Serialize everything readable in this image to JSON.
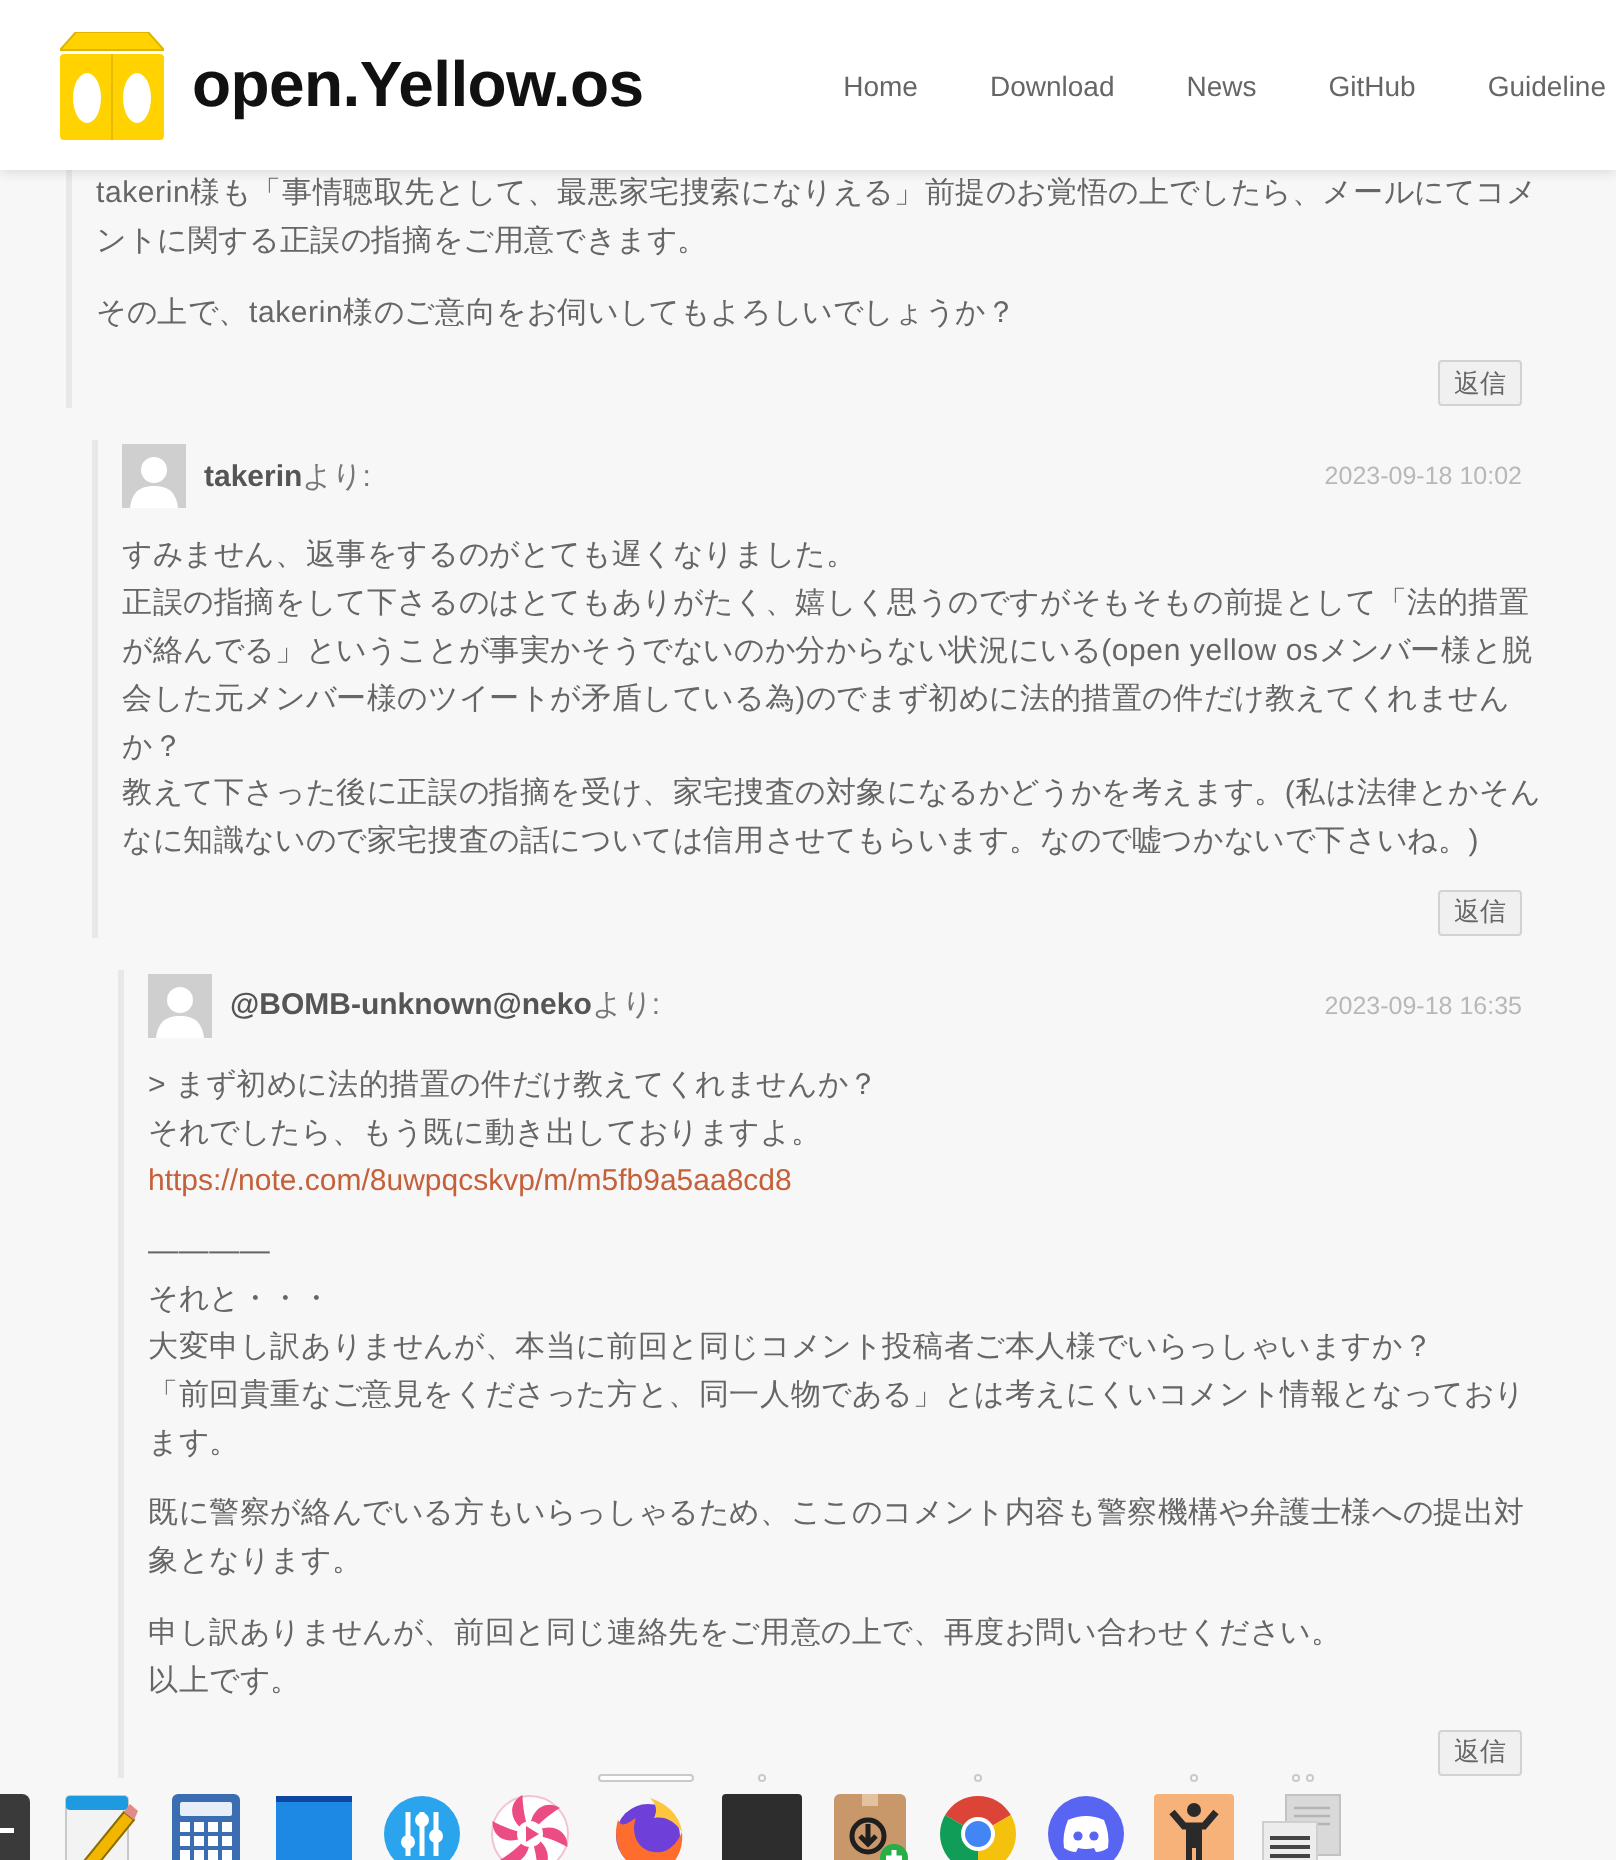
{
  "header": {
    "logo_text": "open.Yellow.os",
    "nav": [
      "Home",
      "Download",
      "News",
      "GitHub",
      "Guideline"
    ]
  },
  "comments": [
    {
      "paragraphs": [
        {
          "lines": [
            {
              "kind": "text",
              "text": "takerin様も「事情聴取先として、最悪家宅捜索になりえる」前提のお覚悟の上でしたら、メールにてコメントに関する正誤の指摘をご用意できます。"
            }
          ]
        },
        {
          "lines": [
            {
              "kind": "text",
              "text": "その上で、takerin様のご意向をお伺いしてもよろしいでしょうか？"
            }
          ]
        }
      ],
      "reply_label": "返信",
      "children": [
        {
          "author": "**takerin**より:",
          "date": "2023-09-18 10:02",
          "paragraphs": [
            {
              "lines": [
                {
                  "kind": "text",
                  "text": "すみません、返事をするのがとても遅くなりました。"
                },
                {
                  "kind": "text",
                  "text": "正誤の指摘をして下さるのはとてもありがたく、嬉しく思うのですがそもそもの前提として「法的措置が絡んでる」ということが事実かそうでないのか分からない状況にいる(open yellow osメンバー様と脱会した元メンバー様のツイートが矛盾している為)のでまず初めに法的措置の件だけ教えてくれませんか？"
                },
                {
                  "kind": "text",
                  "text": "教えて下さった後に正誤の指摘を受け、家宅捜査の対象になるかどうかを考えます。(私は法律とかそんなに知識ないので家宅捜査の話については信用させてもらいます。なので嘘つかないで下さいね。)"
                }
              ]
            }
          ],
          "reply_label": "返信",
          "children": [
            {
              "author": "**@BOMB-unknown@neko**より:",
              "date": "2023-09-18 16:35",
              "paragraphs": [
                {
                  "lines": [
                    {
                      "kind": "text",
                      "text": "> まず初めに法的措置の件だけ教えてくれませんか？"
                    },
                    {
                      "kind": "text",
                      "text": "それでしたら、もう既に動き出しておりますよ。"
                    },
                    {
                      "kind": "link",
                      "text": "https://note.com/8uwpqcskvp/m/m5fb9a5aa8cd8"
                    }
                  ]
                },
                {
                  "lines": [
                    {
                      "kind": "text",
                      "text": "————"
                    },
                    {
                      "kind": "text",
                      "text": "それと・・・"
                    },
                    {
                      "kind": "text",
                      "text": "大変申し訳ありませんが、本当に前回と同じコメント投稿者ご本人様でいらっしゃいますか？"
                    },
                    {
                      "kind": "text",
                      "text": "「前回貴重なご意見をくださった方と、同一人物である」とは考えにくいコメント情報となっております。"
                    }
                  ]
                },
                {
                  "lines": [
                    {
                      "kind": "text",
                      "text": "既に警察が絡んでいる方もいらっしゃるため、ここのコメント内容も警察機構や弁護士様への提出対象となります。"
                    }
                  ]
                },
                {
                  "lines": [
                    {
                      "kind": "text",
                      "text": "申し訳ありませんが、前回と同じ連絡先をご用意の上で、再度お問い合わせください。"
                    },
                    {
                      "kind": "text",
                      "text": "以上です。"
                    }
                  ]
                }
              ],
              "reply_label": "返信"
            }
          ]
        }
      ]
    }
  ],
  "dock": {
    "items": [
      {
        "kind": "minus"
      },
      {
        "kind": "notepad"
      },
      {
        "kind": "calculator"
      },
      {
        "kind": "window"
      },
      {
        "kind": "sliders"
      },
      {
        "kind": "pinwheel"
      },
      {
        "kind": "flamefox",
        "indicators": [
          {
            "kind": "bar"
          }
        ]
      },
      {
        "kind": "blank",
        "indicators": [
          {
            "kind": "dot"
          }
        ]
      },
      {
        "kind": "package"
      },
      {
        "kind": "wheel",
        "indicators": [
          {
            "kind": "dot"
          }
        ]
      },
      {
        "kind": "controller"
      },
      {
        "kind": "figure",
        "indicators": [
          {
            "kind": "dot"
          }
        ]
      },
      {
        "kind": "documents",
        "indicators": [
          {
            "kind": "dot"
          },
          {
            "kind": "dot"
          }
        ]
      }
    ]
  }
}
